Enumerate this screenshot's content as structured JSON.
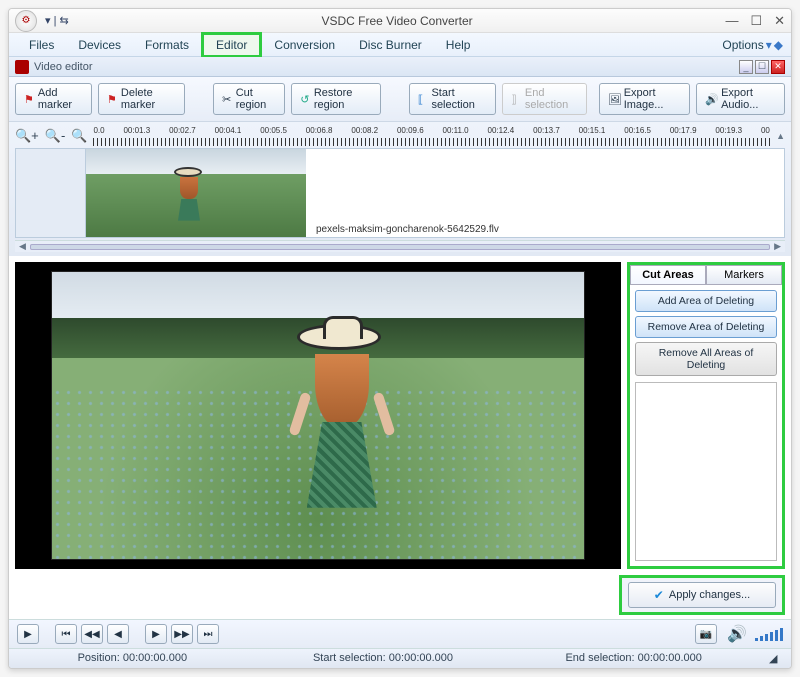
{
  "title": "VSDC Free Video Converter",
  "ribbon": {
    "tabs": [
      "Files",
      "Devices",
      "Formats",
      "Editor",
      "Conversion",
      "Disc Burner",
      "Help"
    ],
    "highlighted": "Editor",
    "options_label": "Options"
  },
  "editor_panel_title": "Video editor",
  "toolbar": {
    "add_marker": "Add marker",
    "delete_marker": "Delete marker",
    "cut_region": "Cut region",
    "restore_region": "Restore region",
    "start_selection": "Start selection",
    "end_selection": "End selection",
    "export_image": "Export Image...",
    "export_audio": "Export Audio..."
  },
  "timeline": {
    "ticks": [
      "0.0",
      "00:01.3",
      "00:02.7",
      "00:04.1",
      "00:05.5",
      "00:06.8",
      "00:08.2",
      "00:09.6",
      "00:11.0",
      "00:12.4",
      "00:13.7",
      "00:15.1",
      "00:16.5",
      "00:17.9",
      "00:19.3",
      "00"
    ],
    "clip_filename": "pexels-maksim-goncharenok-5642529.flv"
  },
  "side": {
    "tab_cut": "Cut Areas",
    "tab_markers": "Markers",
    "btn_add": "Add Area of Deleting",
    "btn_remove": "Remove Area of Deleting",
    "btn_remove_all": "Remove All Areas of Deleting"
  },
  "apply_label": "Apply changes...",
  "status": {
    "position_label": "Position:",
    "position_value": "00:00:00.000",
    "start_label": "Start selection:",
    "start_value": "00:00:00.000",
    "end_label": "End selection:",
    "end_value": "00:00:00.000"
  }
}
